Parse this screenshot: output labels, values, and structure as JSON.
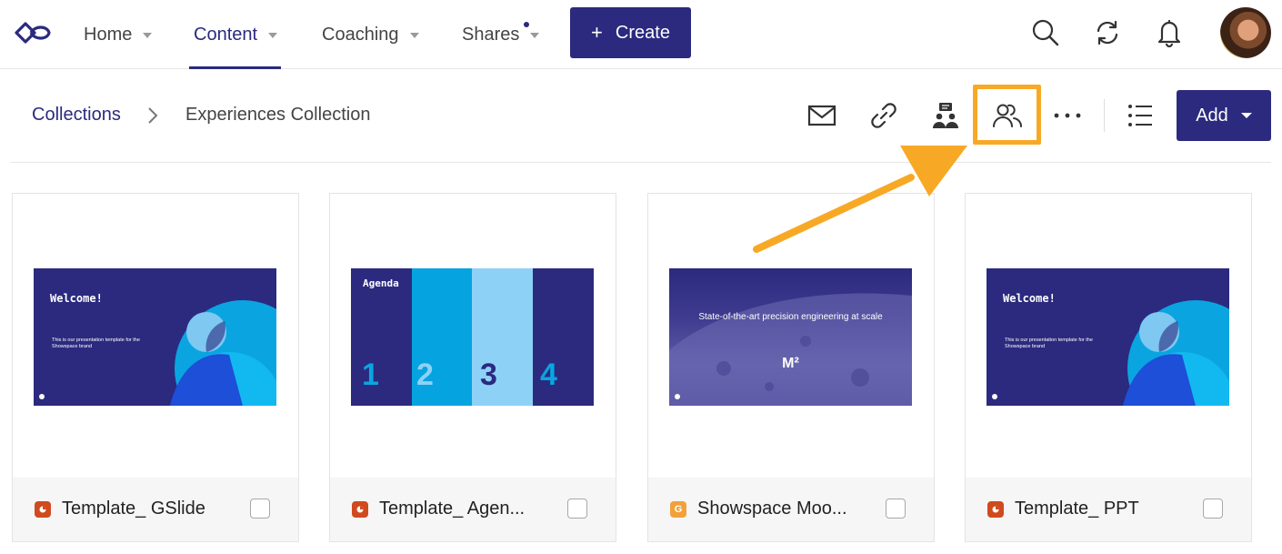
{
  "nav": {
    "items": [
      {
        "label": "Home"
      },
      {
        "label": "Content"
      },
      {
        "label": "Coaching"
      },
      {
        "label": "Shares"
      }
    ],
    "create_label": "Create",
    "create_plus": "+"
  },
  "breadcrumb": {
    "parent": "Collections",
    "current": "Experiences Collection"
  },
  "toolbar": {
    "add_label": "Add",
    "more_label": "···"
  },
  "colors": {
    "brand": "#2b2a7f",
    "highlight": "#f7a926",
    "ppt": "#d04a1f",
    "gslide": "#f2a13a"
  },
  "cards": [
    {
      "name": "Template_ GSlide",
      "type": "ppt-icon",
      "slide": {
        "title": "Welcome!",
        "body": "This is our presentation template for the Showspace brand"
      }
    },
    {
      "name": "Template_ Agen...",
      "type": "ppt-icon",
      "slide": {
        "title": "Agenda",
        "numbers": [
          "1",
          "2",
          "3",
          "4"
        ]
      }
    },
    {
      "name": "Showspace Moo...",
      "type": "gslide-icon",
      "slide": {
        "title": "State-of-the-art precision engineering at scale",
        "mark": "M²"
      }
    },
    {
      "name": "Template_ PPT",
      "type": "ppt-icon",
      "slide": {
        "title": "Welcome!",
        "body": "This is our presentation template for the Showspace brand"
      }
    }
  ]
}
